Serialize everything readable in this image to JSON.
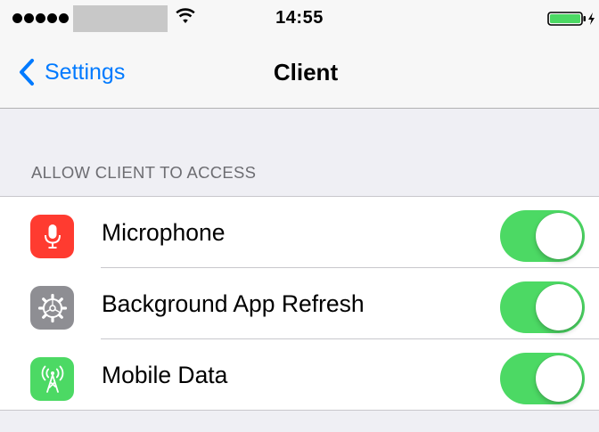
{
  "status_bar": {
    "time": "14:55"
  },
  "nav": {
    "back_label": "Settings",
    "title": "Client"
  },
  "section": {
    "header": "ALLOW CLIENT TO ACCESS"
  },
  "rows": [
    {
      "label": "Microphone",
      "icon": "microphone-icon",
      "icon_color": "#ff3b30",
      "enabled": true
    },
    {
      "label": "Background App Refresh",
      "icon": "gear-icon",
      "icon_color": "#8e8e93",
      "enabled": true
    },
    {
      "label": "Mobile Data",
      "icon": "antenna-icon",
      "icon_color": "#4cd964",
      "enabled": true
    }
  ],
  "colors": {
    "accent": "#007aff",
    "toggle_on": "#4cd964",
    "background": "#efeff4"
  }
}
